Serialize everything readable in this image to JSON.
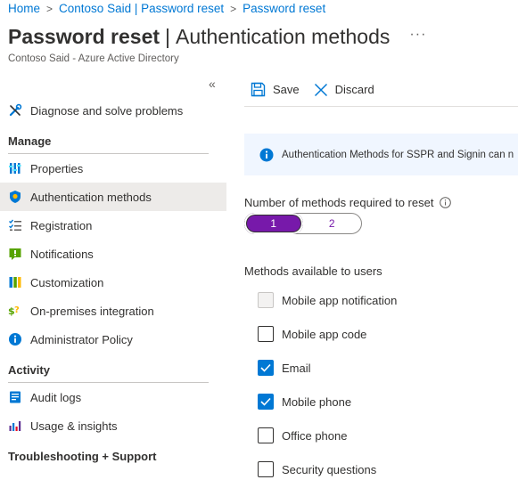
{
  "breadcrumb": {
    "items": [
      "Home",
      "Contoso Said | Password reset",
      "Password reset"
    ],
    "separator": ">"
  },
  "header": {
    "title": "Password reset",
    "title_separator": "|",
    "section": "Authentication methods",
    "more_label": "···",
    "subtitle": "Contoso Said - Azure Active Directory"
  },
  "sidebar": {
    "collapse_label": "«",
    "top_items": [
      {
        "label": "Diagnose and solve problems",
        "icon": "wrench-cross-icon"
      }
    ],
    "sections": [
      {
        "heading": "Manage",
        "items": [
          {
            "label": "Properties",
            "icon": "properties-icon"
          },
          {
            "label": "Authentication methods",
            "icon": "shield-icon",
            "active": true
          },
          {
            "label": "Registration",
            "icon": "checklist-icon"
          },
          {
            "label": "Notifications",
            "icon": "notification-icon"
          },
          {
            "label": "Customization",
            "icon": "customization-icon"
          },
          {
            "label": "On-premises integration",
            "icon": "on-premises-icon"
          },
          {
            "label": "Administrator Policy",
            "icon": "info-icon"
          }
        ]
      },
      {
        "heading": "Activity",
        "items": [
          {
            "label": "Audit logs",
            "icon": "audit-log-icon"
          },
          {
            "label": "Usage & insights",
            "icon": "insights-icon"
          }
        ]
      },
      {
        "heading": "Troubleshooting + Support",
        "items": []
      }
    ]
  },
  "toolbar": {
    "save_label": "Save",
    "discard_label": "Discard"
  },
  "info": {
    "text": "Authentication Methods for SSPR and Signin can n"
  },
  "methods_required": {
    "label": "Number of methods required to reset",
    "options": [
      "1",
      "2"
    ],
    "selected": "1"
  },
  "methods_available": {
    "label": "Methods available to users",
    "items": [
      {
        "label": "Mobile app notification",
        "checked": false,
        "disabled": true
      },
      {
        "label": "Mobile app code",
        "checked": false,
        "disabled": false
      },
      {
        "label": "Email",
        "checked": true,
        "disabled": false
      },
      {
        "label": "Mobile phone",
        "checked": true,
        "disabled": false
      },
      {
        "label": "Office phone",
        "checked": false,
        "disabled": false
      },
      {
        "label": "Security questions",
        "checked": false,
        "disabled": false
      }
    ]
  },
  "colors": {
    "link": "#0078d4",
    "accent_purple": "#7719aa",
    "checkbox_checked": "#0078d4",
    "info_background": "#f0f6ff",
    "active_nav": "#edebe9"
  }
}
